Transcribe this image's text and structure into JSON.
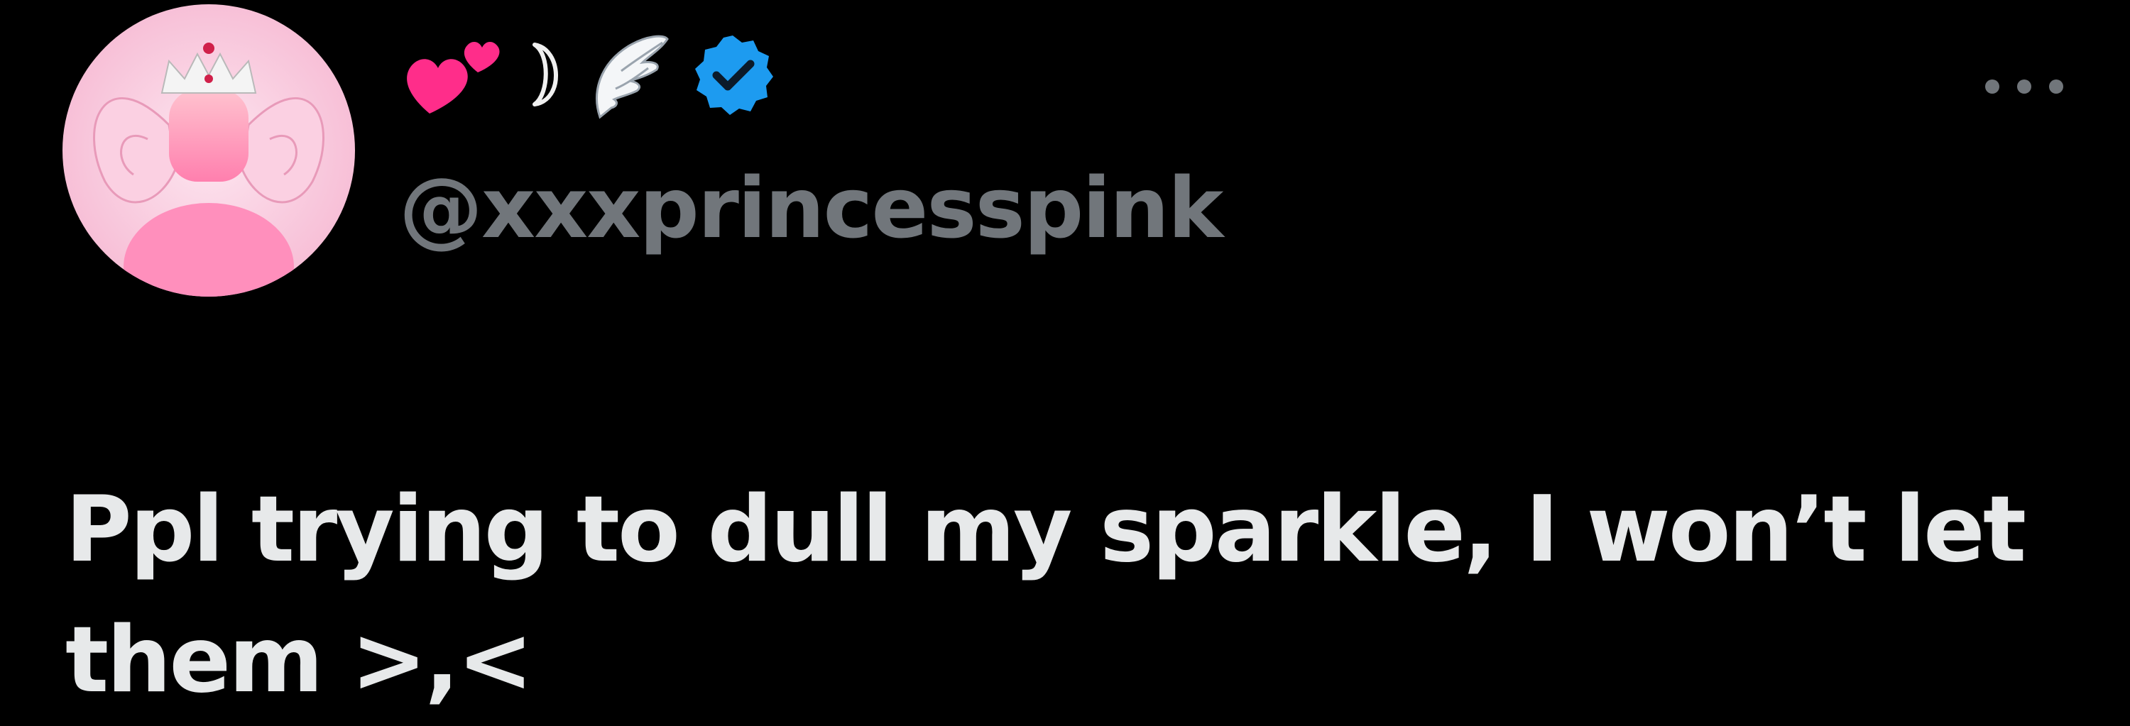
{
  "tweet": {
    "author": {
      "display_name_emojis": [
        "two-hearts-icon",
        "crescent-moon-icon",
        "angel-wing-icon"
      ],
      "verified": true,
      "handle": "@xxxprincesspink",
      "avatar": "pink-fairy-princess-avatar"
    },
    "text": "Ppl trying to dull my sparkle, I won’t let them >,<",
    "colors": {
      "background": "#000000",
      "text": "#e7e9ea",
      "muted": "#71767b",
      "verified_badge": "#1d9bf0",
      "heart": "#ff2d8a"
    }
  }
}
